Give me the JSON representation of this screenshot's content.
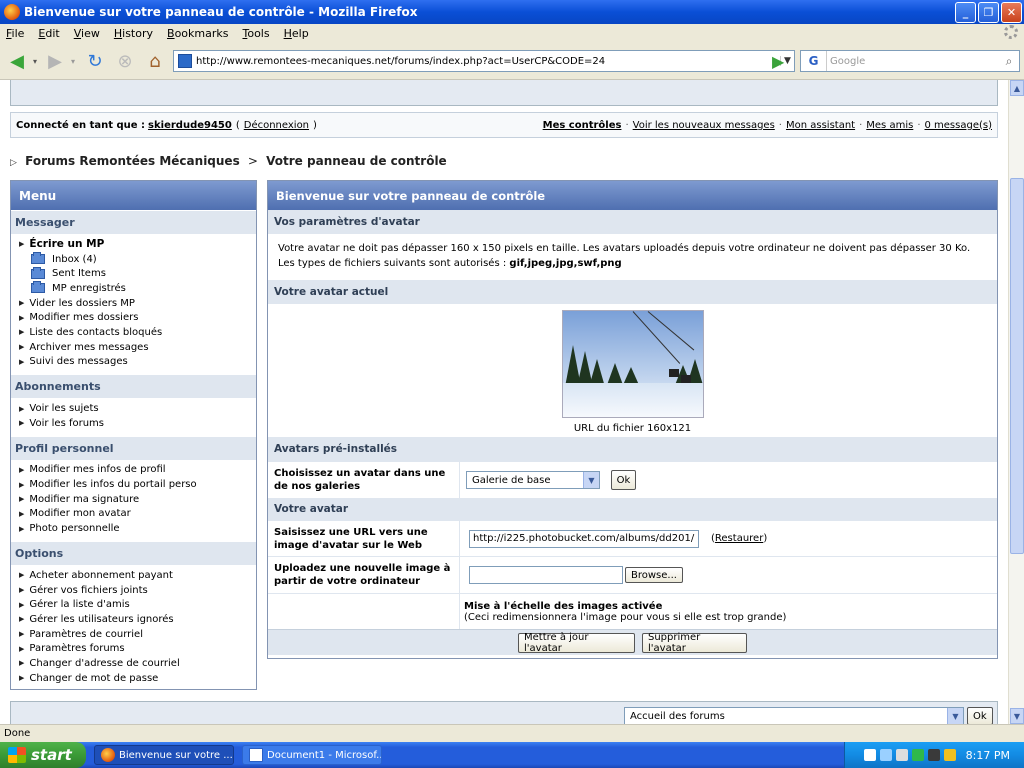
{
  "window": {
    "title": "Bienvenue sur votre panneau de contrôle - Mozilla Firefox",
    "buttons": [
      "_",
      "❐",
      "✕"
    ]
  },
  "menubar": [
    "File",
    "Edit",
    "View",
    "History",
    "Bookmarks",
    "Tools",
    "Help"
  ],
  "toolbar": {
    "url": "http://www.remontees-mecaniques.net/forums/index.php?act=UserCP&CODE=24",
    "search_placeholder": "Google",
    "search_engine_icon": "G"
  },
  "userbar": {
    "connected_label": "Connecté en tant que :",
    "username": "skierdude9450",
    "logout": "Déconnexion",
    "links": [
      "Mes contrôles",
      "Voir les nouveaux messages",
      "Mon assistant",
      "Mes amis",
      "0 message(s)"
    ]
  },
  "breadcrumb": {
    "forum": "Forums Remontées Mécaniques",
    "separator": ">",
    "current": "Votre panneau de contrôle"
  },
  "menu": {
    "title": "Menu",
    "sections": [
      {
        "title": "Messager",
        "items": [
          {
            "label": "Écrire un MP",
            "type": "bold"
          },
          {
            "label": "Inbox (4)",
            "type": "folder"
          },
          {
            "label": "Sent Items",
            "type": "folder"
          },
          {
            "label": "MP enregistrés",
            "type": "folder"
          },
          {
            "label": "Vider les dossiers MP",
            "type": "bullet"
          },
          {
            "label": "Modifier mes dossiers",
            "type": "bullet"
          },
          {
            "label": "Liste des contacts bloqués",
            "type": "bullet"
          },
          {
            "label": "Archiver mes messages",
            "type": "bullet"
          },
          {
            "label": "Suivi des messages",
            "type": "bullet"
          }
        ]
      },
      {
        "title": "Abonnements",
        "items": [
          {
            "label": "Voir les sujets",
            "type": "bullet"
          },
          {
            "label": "Voir les forums",
            "type": "bullet"
          }
        ]
      },
      {
        "title": "Profil personnel",
        "items": [
          {
            "label": "Modifier mes infos de profil",
            "type": "bullet"
          },
          {
            "label": "Modifier les infos du portail perso",
            "type": "bullet"
          },
          {
            "label": "Modifier ma signature",
            "type": "bullet"
          },
          {
            "label": "Modifier mon avatar",
            "type": "bullet"
          },
          {
            "label": "Photo personnelle",
            "type": "bullet"
          }
        ]
      },
      {
        "title": "Options",
        "items": [
          {
            "label": "Acheter abonnement payant",
            "type": "bullet"
          },
          {
            "label": "Gérer vos fichiers joints",
            "type": "bullet"
          },
          {
            "label": "Gérer la liste d'amis",
            "type": "bullet"
          },
          {
            "label": "Gérer les utilisateurs ignorés",
            "type": "bullet"
          },
          {
            "label": "Paramètres de courriel",
            "type": "bullet"
          },
          {
            "label": "Paramètres forums",
            "type": "bullet"
          },
          {
            "label": "Changer d'adresse de courriel",
            "type": "bullet"
          },
          {
            "label": "Changer de mot de passe",
            "type": "bullet"
          }
        ]
      }
    ]
  },
  "panel": {
    "title": "Bienvenue sur votre panneau de contrôle",
    "params_title": "Vos paramètres d'avatar",
    "params_text": "Votre avatar ne doit pas dépasser 160 x 150 pixels en taille. Les avatars uploadés depuis votre ordinateur ne doivent pas dépasser 30 Ko.",
    "types_label": "Les types de fichiers suivants sont autorisés :",
    "types_value": "gif,jpeg,jpg,swf,png",
    "current_title": "Votre avatar actuel",
    "avatar_caption": "URL du fichier 160x121",
    "preinstalled_title": "Avatars pré-installés",
    "gallery_label": "Choisissez un avatar dans une de nos galeries",
    "gallery_value": "Galerie de base",
    "gallery_ok": "Ok",
    "your_avatar_title": "Votre avatar",
    "url_label": "Saisissez une URL vers une image d'avatar sur le Web",
    "url_value": "http://i225.photobucket.com/albums/dd201/",
    "restore_label": "Restaurer",
    "upload_label": "Uploadez une nouvelle image à partir de votre ordinateur",
    "browse_label": "Browse...",
    "scaling_title": "Mise à l'échelle des images activée",
    "scaling_note": "(Ceci redimensionnera l'image pour vous si elle est trop grande)",
    "update_button": "Mettre à jour l'avatar",
    "delete_button": "Supprimer l'avatar"
  },
  "jump": {
    "select_value": "Accueil des forums",
    "ok": "Ok"
  },
  "status": "Done",
  "taskbar": {
    "start": "start",
    "tasks": [
      {
        "label": "Bienvenue sur votre ...",
        "active": true,
        "icon": "firefox-icon"
      },
      {
        "label": "Document1 - Microsof...",
        "active": false,
        "icon": "word-icon"
      }
    ],
    "clock": "8:17 PM"
  }
}
